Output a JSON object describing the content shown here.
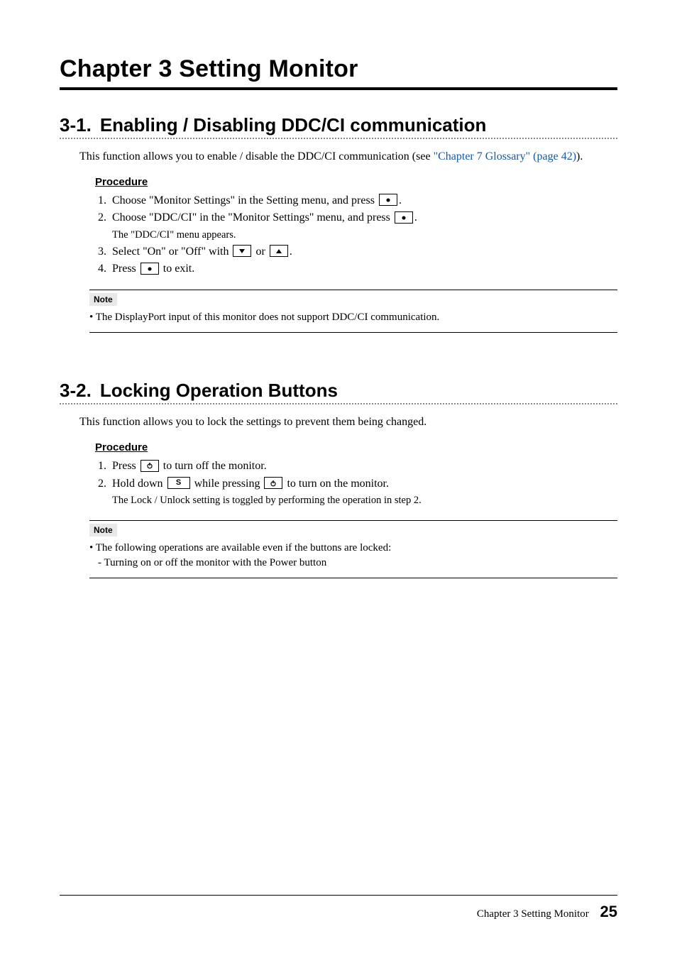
{
  "chapter": {
    "title": "Chapter 3   Setting Monitor"
  },
  "sec31": {
    "num": "3-1.",
    "title": "Enabling / Disabling DDC/CI communication",
    "intro_pre": "This function allows you to enable / disable the DDC/CI communication (see ",
    "intro_link": "\"Chapter 7 Glossary\" (page 42)",
    "intro_post": ").",
    "proc_heading": "Procedure",
    "step1_a": "Choose \"Monitor Settings\" in the Setting menu, and press ",
    "step1_b": ".",
    "step2_a": "Choose \"DDC/CI\" in the \"Monitor Settings\" menu, and press ",
    "step2_b": ".",
    "step2_sub": "The \"DDC/CI\" menu appears.",
    "step3_a": "Select \"On\" or \"Off\" with ",
    "step3_b": " or ",
    "step3_c": ".",
    "step4_a": "Press ",
    "step4_b": " to exit.",
    "note_label": "Note",
    "note_text": "• The DisplayPort input of this monitor does not support DDC/CI communication."
  },
  "sec32": {
    "num": "3-2.",
    "title": "Locking Operation Buttons",
    "intro": "This function allows you to lock the settings to prevent them being changed.",
    "proc_heading": "Procedure",
    "step1_a": "Press ",
    "step1_b": " to turn off the monitor.",
    "step2_a": "Hold down ",
    "step2_b": " while pressing ",
    "step2_c": " to turn on the monitor.",
    "step2_sub": "The Lock / Unlock setting is toggled by performing the operation in step 2.",
    "note_label": "Note",
    "note_line1": "• The following operations are available even if the buttons are locked:",
    "note_line2": "- Turning on or off the monitor with the Power button"
  },
  "footer": {
    "label": "Chapter 3 Setting Monitor",
    "page": "25"
  },
  "icons": {
    "enter": "enter-icon",
    "down": "down-arrow-icon",
    "up": "up-arrow-icon",
    "power": "power-icon",
    "s": "S"
  }
}
